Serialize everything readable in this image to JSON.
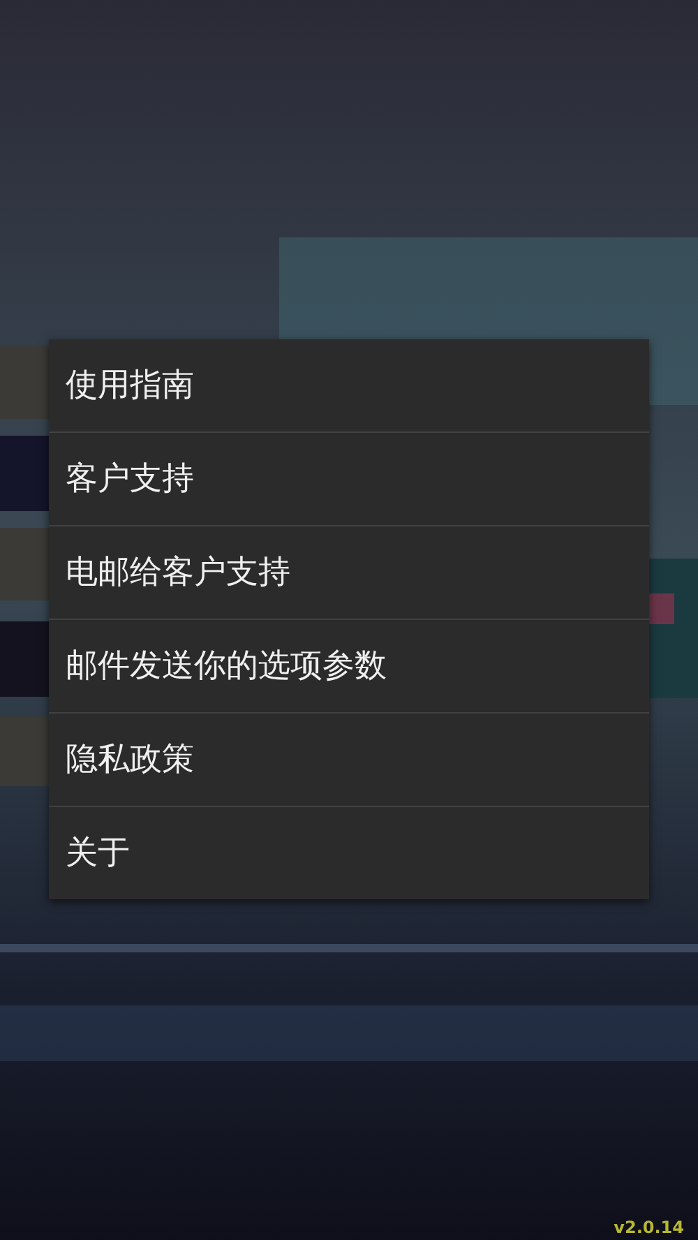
{
  "menu": {
    "items": [
      {
        "label": "使用指南"
      },
      {
        "label": "客户支持"
      },
      {
        "label": "电邮给客户支持"
      },
      {
        "label": "邮件发送你的选项参数"
      },
      {
        "label": "隐私政策"
      },
      {
        "label": "关于"
      }
    ]
  },
  "version": "v2.0.14"
}
